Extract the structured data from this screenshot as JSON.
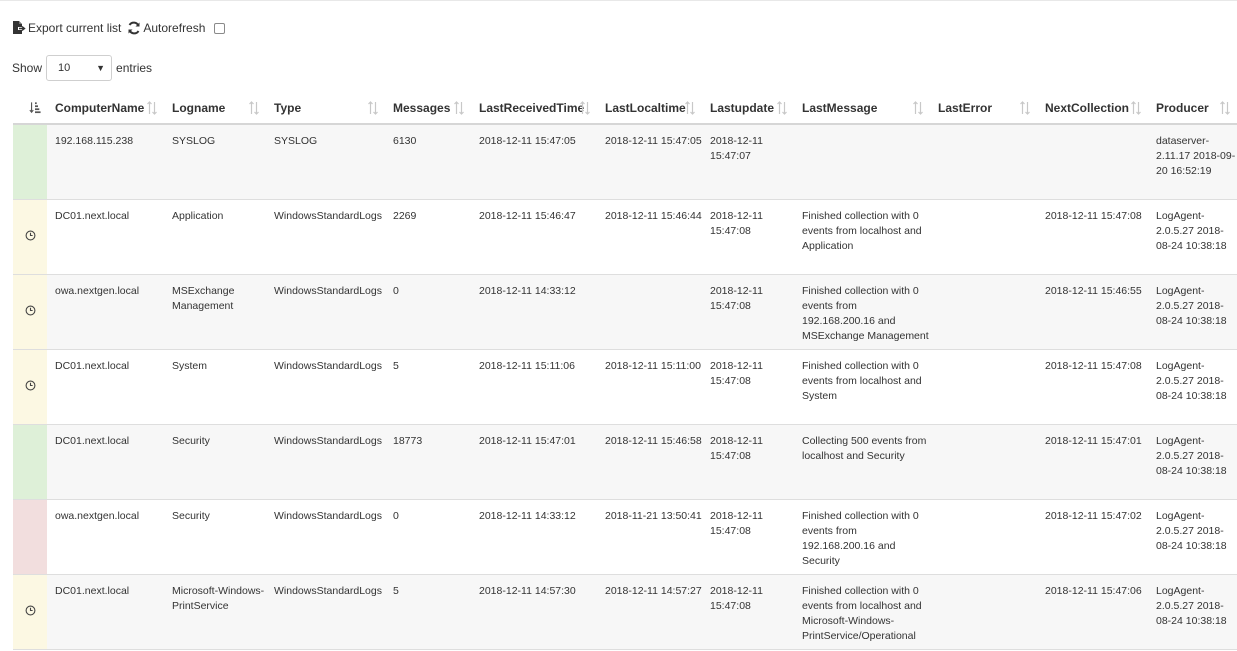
{
  "toolbar": {
    "export_label": "Export current list",
    "autorefresh_label": "Autorefresh"
  },
  "length": {
    "show_label": "Show",
    "selected": "10",
    "entries_label": "entries"
  },
  "columns": [
    "ComputerName",
    "Logname",
    "Type",
    "Messages",
    "LastReceivedTime",
    "LastLocaltime",
    "Lastupdate",
    "LastMessage",
    "LastError",
    "NextCollection",
    "Producer"
  ],
  "rows": [
    {
      "status": "green",
      "icon": "",
      "computer": "192.168.115.238",
      "logname": "SYSLOG",
      "type": "SYSLOG",
      "messages": "6130",
      "lastreceived": "2018-12-11 15:47:05",
      "lastlocal": "2018-12-11 15:47:05",
      "lastupdate": "2018-12-11 15:47:07",
      "lastmessage": "",
      "lasterror": "",
      "nextcollection": "",
      "producer": "dataserver-2.11.17 2018-09-20 16:52:19"
    },
    {
      "status": "yellow",
      "icon": "clock-icon",
      "computer": "DC01.next.local",
      "logname": "Application",
      "type": "WindowsStandardLogs",
      "messages": "2269",
      "lastreceived": "2018-12-11 15:46:47",
      "lastlocal": "2018-12-11 15:46:44",
      "lastupdate": "2018-12-11 15:47:08",
      "lastmessage": "Finished collection with 0 events from localhost and Application",
      "lasterror": "",
      "nextcollection": "2018-12-11 15:47:08",
      "producer": "LogAgent-2.0.5.27 2018-08-24 10:38:18"
    },
    {
      "status": "yellow",
      "icon": "clock-icon",
      "computer": "owa.nextgen.local",
      "logname": "MSExchange Management",
      "type": "WindowsStandardLogs",
      "messages": "0",
      "lastreceived": "2018-12-11 14:33:12",
      "lastlocal": "",
      "lastupdate": "2018-12-11 15:47:08",
      "lastmessage": "Finished collection with 0 events from 192.168.200.16 and MSExchange Management",
      "lasterror": "",
      "nextcollection": "2018-12-11 15:46:55",
      "producer": "LogAgent-2.0.5.27 2018-08-24 10:38:18"
    },
    {
      "status": "yellow",
      "icon": "clock-icon",
      "computer": "DC01.next.local",
      "logname": "System",
      "type": "WindowsStandardLogs",
      "messages": "5",
      "lastreceived": "2018-12-11 15:11:06",
      "lastlocal": "2018-12-11 15:11:00",
      "lastupdate": "2018-12-11 15:47:08",
      "lastmessage": "Finished collection with 0 events from localhost and System",
      "lasterror": "",
      "nextcollection": "2018-12-11 15:47:08",
      "producer": "LogAgent-2.0.5.27 2018-08-24 10:38:18"
    },
    {
      "status": "green",
      "icon": "",
      "computer": "DC01.next.local",
      "logname": "Security",
      "type": "WindowsStandardLogs",
      "messages": "18773",
      "lastreceived": "2018-12-11 15:47:01",
      "lastlocal": "2018-12-11 15:46:58",
      "lastupdate": "2018-12-11 15:47:08",
      "lastmessage": "Collecting 500 events from localhost and Security",
      "lasterror": "",
      "nextcollection": "2018-12-11 15:47:01",
      "producer": "LogAgent-2.0.5.27 2018-08-24 10:38:18"
    },
    {
      "status": "red",
      "icon": "",
      "computer": "owa.nextgen.local",
      "logname": "Security",
      "type": "WindowsStandardLogs",
      "messages": "0",
      "lastreceived": "2018-12-11 14:33:12",
      "lastlocal": "2018-11-21 13:50:41",
      "lastupdate": "2018-12-11 15:47:08",
      "lastmessage": "Finished collection with 0 events from 192.168.200.16 and Security",
      "lasterror": "",
      "nextcollection": "2018-12-11 15:47:02",
      "producer": "LogAgent-2.0.5.27 2018-08-24 10:38:18"
    },
    {
      "status": "yellow",
      "icon": "clock-icon",
      "computer": "DC01.next.local",
      "logname": "Microsoft-Windows-PrintService",
      "type": "WindowsStandardLogs",
      "messages": "5",
      "lastreceived": "2018-12-11 14:57:30",
      "lastlocal": "2018-12-11 14:57:27",
      "lastupdate": "2018-12-11 15:47:08",
      "lastmessage": "Finished collection with 0 events from localhost and Microsoft-Windows-PrintService/Operational",
      "lasterror": "",
      "nextcollection": "2018-12-11 15:47:06",
      "producer": "LogAgent-2.0.5.27 2018-08-24 10:38:18"
    }
  ],
  "colors": {
    "green": "#def0d8",
    "yellow": "#fcf8e3",
    "red": "#f2dede"
  }
}
